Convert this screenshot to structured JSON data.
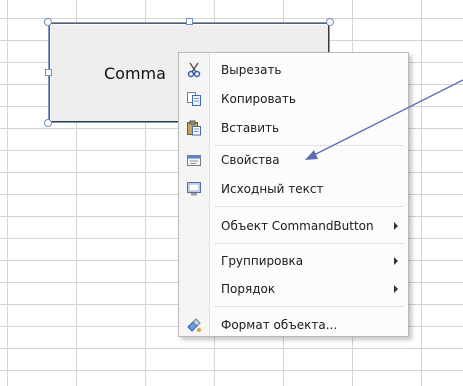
{
  "control": {
    "caption": "Comma"
  },
  "context_menu": {
    "items": [
      {
        "label": "Вырезать",
        "icon": "scissors-icon"
      },
      {
        "label": "Копировать",
        "icon": "copy-icon"
      },
      {
        "label": "Вставить",
        "icon": "paste-icon"
      },
      {
        "label": "Свойства",
        "icon": "properties-icon"
      },
      {
        "label": "Исходный текст",
        "icon": "view-code-icon"
      },
      {
        "label": "Объект CommandButton",
        "submenu": true
      },
      {
        "label": "Группировка",
        "submenu": true
      },
      {
        "label": "Порядок",
        "submenu": true
      },
      {
        "label": "Формат объекта...",
        "icon": "format-object-icon"
      }
    ]
  },
  "colors": {
    "menu_background": "#fcfcfc",
    "selection_handles": "#6f8fbc",
    "pointer_arrow": "#5a6fb2"
  }
}
